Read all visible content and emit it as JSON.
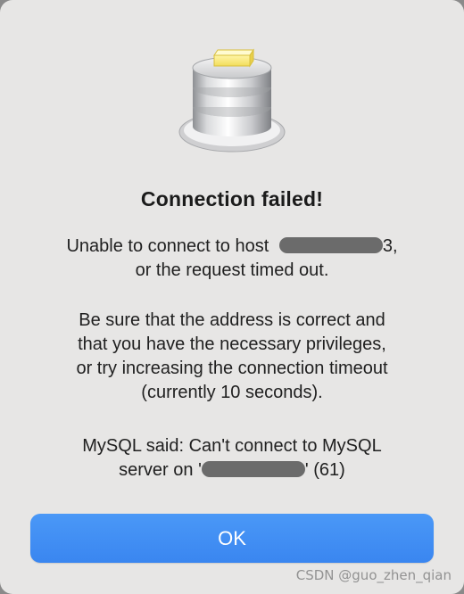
{
  "dialog": {
    "icon": "database-app-icon",
    "title": "Connection failed!",
    "line1_prefix": "Unable to connect to host ",
    "line1_suffix": "3,",
    "line2": "or the request timed out.",
    "para2": [
      "Be sure that the address is correct and",
      "that you have the necessary privileges,",
      "or try increasing the connection timeout",
      "(currently 10 seconds)."
    ],
    "mysql_line1": "MySQL said: Can't connect to MySQL",
    "mysql_line2_prefix": "server on '",
    "mysql_line2_suffix": "' (61)",
    "ok_label": "OK"
  },
  "watermark": "CSDN @guo_zhen_qian",
  "colors": {
    "dialog_bg": "#e7e6e5",
    "button_blue": "#3a86f0",
    "redaction": "#6b6b6b"
  }
}
